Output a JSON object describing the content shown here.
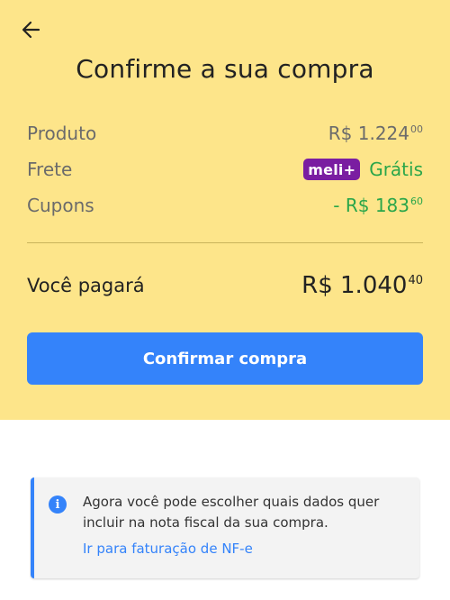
{
  "header": {
    "back_icon": "arrow-left-icon",
    "title": "Confirme a sua compra"
  },
  "summary": {
    "produto": {
      "label": "Produto",
      "currency": "R$",
      "amount": "1.224",
      "cents": "00"
    },
    "frete": {
      "label": "Frete",
      "badge": "meli+",
      "badge_color": "#7a1ea1",
      "value": "Grátis"
    },
    "cupons": {
      "label": "Cupons",
      "prefix": "- R$",
      "amount": "183",
      "cents": "60"
    },
    "total": {
      "label": "Você pagará",
      "currency": "R$",
      "amount": "1.040",
      "cents": "40"
    }
  },
  "actions": {
    "confirm_label": "Confirmar compra"
  },
  "notice": {
    "icon": "info-icon",
    "text": "Agora você pode escolher quais dados quer incluir na nota fiscal da sua compra.",
    "link": "Ir para faturação de NF-e"
  },
  "colors": {
    "header_bg": "#fde58a",
    "primary": "#3483fa",
    "success": "#2aa64a"
  }
}
